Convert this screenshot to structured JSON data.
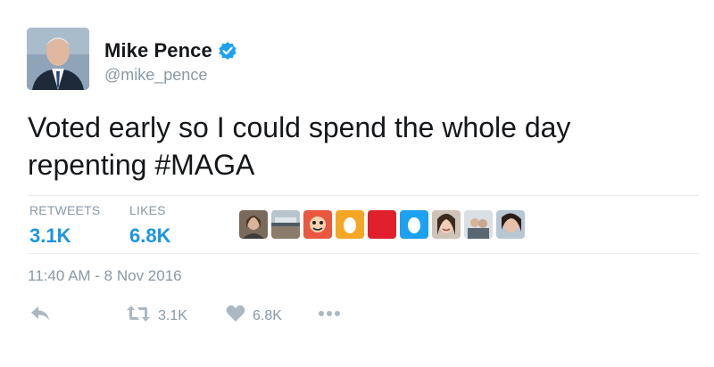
{
  "author": {
    "display_name": "Mike Pence",
    "handle": "@mike_pence",
    "verified": true
  },
  "tweet": {
    "text_lines": [
      "Voted early so I could spend the whole day",
      "repenting #MAGA"
    ]
  },
  "stats": {
    "retweets_label": "RETWEETS",
    "retweets_value": "3.1K",
    "likes_label": "LIKES",
    "likes_value": "6.8K"
  },
  "likers_count_shown": 9,
  "timestamp": "11:40 AM - 8 Nov 2016",
  "actions": {
    "retweet_count": "3.1K",
    "like_count": "6.8K"
  },
  "colors": {
    "accent": "#1b95e0",
    "muted": "#8899a6",
    "icon": "#aab8c2"
  },
  "icons": [
    "verified-badge-icon",
    "reply-icon",
    "retweet-icon",
    "heart-icon",
    "more-icon"
  ]
}
